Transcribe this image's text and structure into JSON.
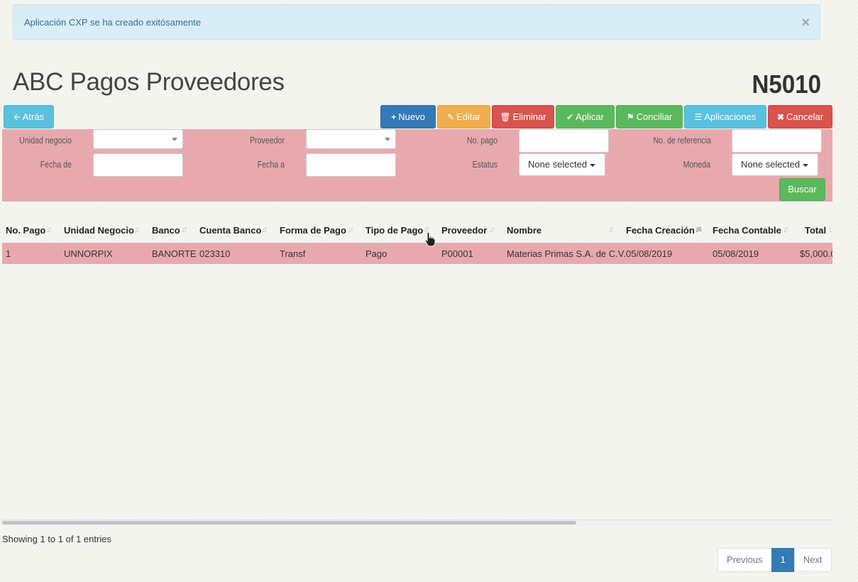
{
  "alert": {
    "message": "Aplicación CXP se ha creado exitósamente",
    "close": "×"
  },
  "header": {
    "title": "ABC Pagos Proveedores",
    "code": "N5010"
  },
  "toolbar": {
    "back": "Atrás",
    "new": "Nuevo",
    "edit": "Editar",
    "delete": "Eliminar",
    "apply": "Aplicar",
    "reconcile": "Conciliar",
    "applications": "Aplicaciones",
    "cancel": "Cancelar"
  },
  "filters": {
    "unidad_negocio": "Unidad negocio",
    "proveedor": "Proveedor",
    "no_pago": "No. pago",
    "no_referencia": "No. de referencia",
    "fecha_de": "Fecha de",
    "fecha_a": "Fecha a",
    "estatus": "Estatus",
    "estatus_value": "None selected",
    "moneda": "Moneda",
    "moneda_value": "None selected",
    "search": "Buscar"
  },
  "table": {
    "columns": [
      "No. Pago",
      "Unidad Negocio",
      "Banco",
      "Cuenta Banco",
      "Forma de Pago",
      "Tipo de Pago",
      "Proveedor",
      "Nombre",
      "Fecha Creación",
      "Fecha Contable",
      "Total"
    ],
    "rows": [
      [
        "1",
        "UNNORPIX",
        "BANORTE",
        "023310",
        "Transf",
        "Pago",
        "P00001",
        "Materias Primas S.A. de C.V.",
        "05/08/2019",
        "05/08/2019",
        "$5,000.0"
      ]
    ]
  },
  "footer": {
    "info": "Showing 1 to 1 of 1 entries",
    "previous": "Previous",
    "page": "1",
    "next": "Next"
  },
  "colors": {
    "row_highlight": "#e8a9ae",
    "alert_bg": "#d9edf7",
    "primary": "#337ab7"
  }
}
